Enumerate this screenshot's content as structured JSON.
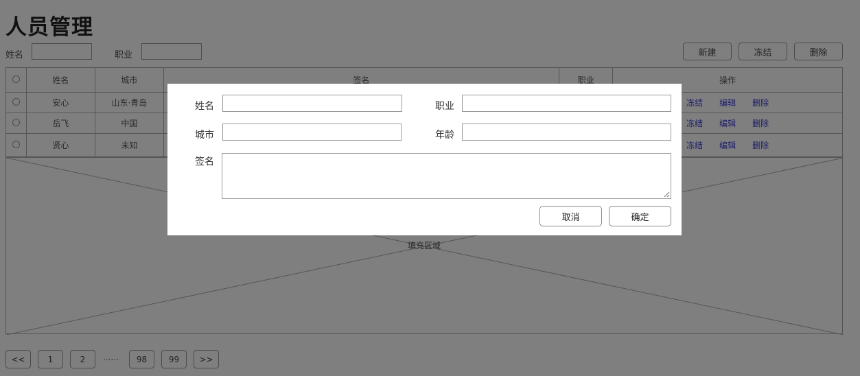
{
  "page": {
    "title": "人员管理"
  },
  "search": {
    "name_label": "姓名",
    "job_label": "职业",
    "name_value": "",
    "job_value": ""
  },
  "toolbar": {
    "new_label": "新建",
    "freeze_label": "冻结",
    "delete_label": "删除"
  },
  "table": {
    "headers": [
      "姓名",
      "城市",
      "签名",
      "职业",
      "操作"
    ],
    "rows": [
      {
        "name": "安心",
        "city": "山东·青岛",
        "ops": [
          "冻结",
          "编辑",
          "删除"
        ]
      },
      {
        "name": "岳飞",
        "city": "中国",
        "ops": [
          "冻结",
          "编辑",
          "删除"
        ]
      },
      {
        "name": "贤心",
        "city": "未知",
        "ops": [
          "冻结",
          "编辑",
          "删除"
        ]
      }
    ]
  },
  "fill_area": {
    "label": "填充区域"
  },
  "pagination": {
    "prev": "<<",
    "pages": [
      "1",
      "2",
      "98",
      "99"
    ],
    "ellipsis": "......",
    "next": ">>"
  },
  "dialog": {
    "name_label": "姓名",
    "job_label": "职业",
    "city_label": "城市",
    "age_label": "年龄",
    "signature_label": "签名",
    "cancel_label": "取消",
    "confirm_label": "确定"
  },
  "colors": {
    "link": "#3b3bd6",
    "overlay": "rgba(0,0,0,0.5)"
  }
}
